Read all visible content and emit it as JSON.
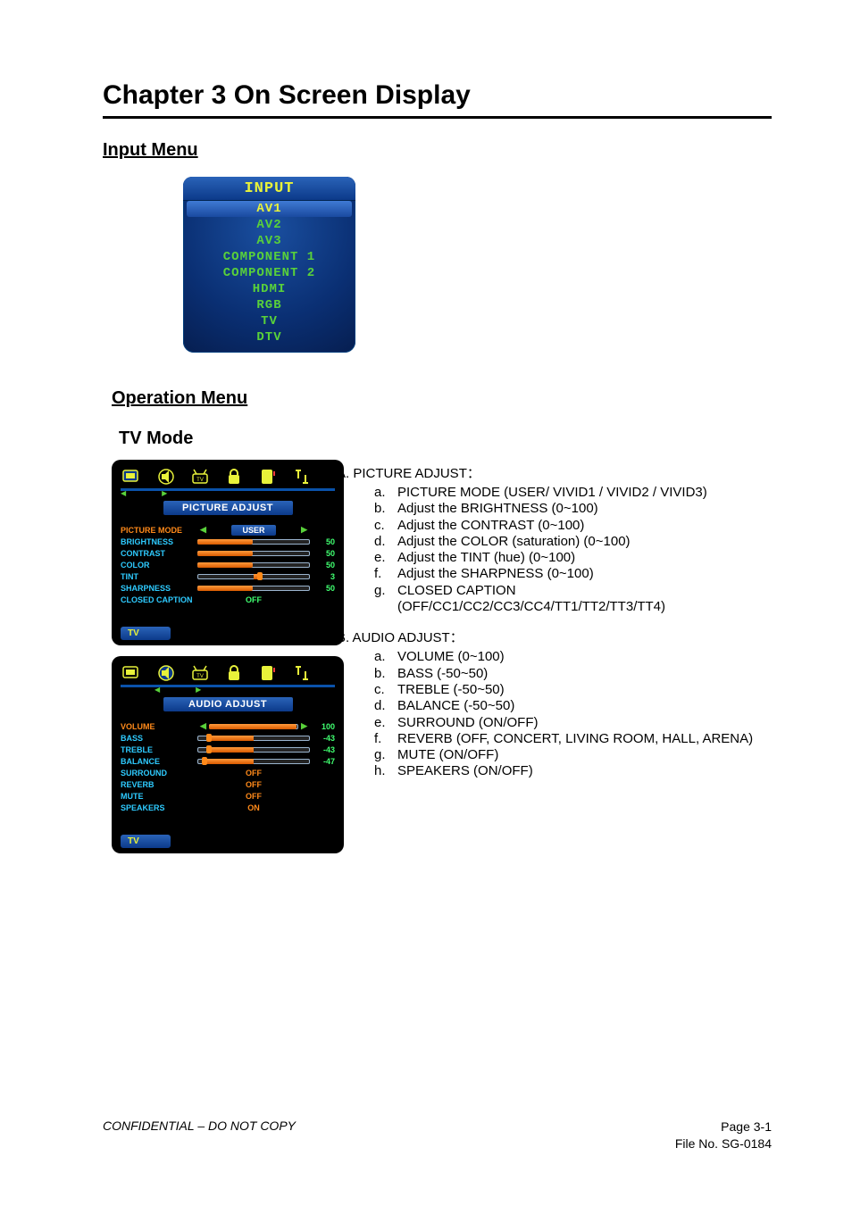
{
  "chapter": {
    "title": "Chapter 3    On Screen Display"
  },
  "input_section": {
    "heading": "Input Menu",
    "panel_title": "INPUT",
    "items": [
      {
        "label": "AV1",
        "selected": true
      },
      {
        "label": "AV2",
        "selected": false
      },
      {
        "label": "AV3",
        "selected": false
      },
      {
        "label": "COMPONENT 1",
        "selected": false
      },
      {
        "label": "COMPONENT 2",
        "selected": false
      },
      {
        "label": "HDMI",
        "selected": false
      },
      {
        "label": "RGB",
        "selected": false
      },
      {
        "label": "TV",
        "selected": false
      },
      {
        "label": "DTV",
        "selected": false
      }
    ]
  },
  "operation": {
    "heading": "Operation Menu",
    "tv_mode": "TV Mode"
  },
  "picture_osd": {
    "title": "PICTURE ADJUST",
    "source": "TV",
    "mode_label": "PICTURE MODE",
    "mode_value": "USER",
    "rows": [
      {
        "label": "BRIGHTNESS",
        "value": "50",
        "fill_pct": 50
      },
      {
        "label": "CONTRAST",
        "value": "50",
        "fill_pct": 50
      },
      {
        "label": "COLOR",
        "value": "50",
        "fill_pct": 50
      },
      {
        "label": "TINT",
        "value": "3",
        "center_offset_pct": 3
      },
      {
        "label": "SHARPNESS",
        "value": "50",
        "fill_pct": 50
      }
    ],
    "caption_label": "CLOSED CAPTION",
    "caption_value": "OFF"
  },
  "audio_osd": {
    "title": "AUDIO ADJUST",
    "source": "TV",
    "volume_label": "VOLUME",
    "volume_value": "100",
    "rows": [
      {
        "label": "BASS",
        "value": "-43",
        "center_offset_pct": -43
      },
      {
        "label": "TREBLE",
        "value": "-43",
        "center_offset_pct": -43
      },
      {
        "label": "BALANCE",
        "value": "-47",
        "center_offset_pct": -47
      }
    ],
    "toggles": [
      {
        "label": "SURROUND",
        "value": "OFF"
      },
      {
        "label": "REVERB",
        "value": "OFF"
      },
      {
        "label": "MUTE",
        "value": "OFF"
      },
      {
        "label": "SPEAKERS",
        "value": "ON"
      }
    ]
  },
  "picture_text": {
    "title": "A. PICTURE ADJUST：",
    "items": [
      {
        "m": "a.",
        "t": "PICTURE MODE (USER/ VIVID1 / VIVID2 / VIVID3)"
      },
      {
        "m": "b.",
        "t": "Adjust the BRIGHTNESS (0~100)"
      },
      {
        "m": "c.",
        "t": "Adjust the CONTRAST (0~100)"
      },
      {
        "m": "d.",
        "t": "Adjust the COLOR (saturation) (0~100)"
      },
      {
        "m": "e.",
        "t": "Adjust the TINT (hue) (0~100)"
      },
      {
        "m": "f.",
        "t": "Adjust the SHARPNESS (0~100)"
      },
      {
        "m": "g.",
        "t": "CLOSED CAPTION (OFF/CC1/CC2/CC3/CC4/TT1/TT2/TT3/TT4)"
      }
    ]
  },
  "audio_text": {
    "title": "B. AUDIO ADJUST：",
    "items": [
      {
        "m": "a.",
        "t": "VOLUME (0~100)"
      },
      {
        "m": "b.",
        "t": "BASS (-50~50)"
      },
      {
        "m": "c.",
        "t": "TREBLE (-50~50)"
      },
      {
        "m": "d.",
        "t": "BALANCE (-50~50)"
      },
      {
        "m": "e.",
        "t": "SURROUND (ON/OFF)"
      },
      {
        "m": "f.",
        "t": "REVERB (OFF, CONCERT, LIVING ROOM, HALL, ARENA)"
      },
      {
        "m": "g.",
        "t": "MUTE (ON/OFF)"
      },
      {
        "m": "h.",
        "t": "SPEAKERS (ON/OFF)"
      }
    ]
  },
  "footer": {
    "confidential": "CONFIDENTIAL – DO NOT COPY",
    "page": "Page  3-1",
    "file": "File  No.  SG-0184"
  }
}
